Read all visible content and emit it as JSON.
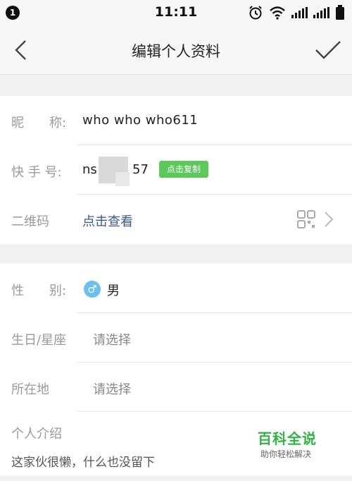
{
  "status_bar": {
    "notification_count": "1",
    "time": "11:11"
  },
  "nav": {
    "title": "编辑个人资料",
    "back_icon": "chevron-left-icon",
    "confirm_icon": "checkmark-icon"
  },
  "profile": {
    "nickname_label": "昵　　称:",
    "nickname_value": "who who who611",
    "kuaishou_label": "快 手 号:",
    "kuaishou_prefix": "ns",
    "kuaishou_suffix": "57",
    "copy_button": "点击复制",
    "qrcode_label": "二维码",
    "qrcode_action": "点击查看"
  },
  "details": {
    "gender_label": "性　　别:",
    "gender_value": "男",
    "birthday_label": "生日/星座",
    "birthday_placeholder": "请选择",
    "location_label": "所在地",
    "location_placeholder": "请选择",
    "intro_label": "个人介绍",
    "intro_value": "这家伙很懒，什么也没留下"
  },
  "watermark": {
    "title": "百科全说",
    "subtitle": "助你轻松解决"
  },
  "colors": {
    "accent_green": "#5cc85c",
    "link_blue": "#3a5a8c",
    "gender_blue": "#6cc0ef",
    "watermark_green": "#2fb341"
  }
}
